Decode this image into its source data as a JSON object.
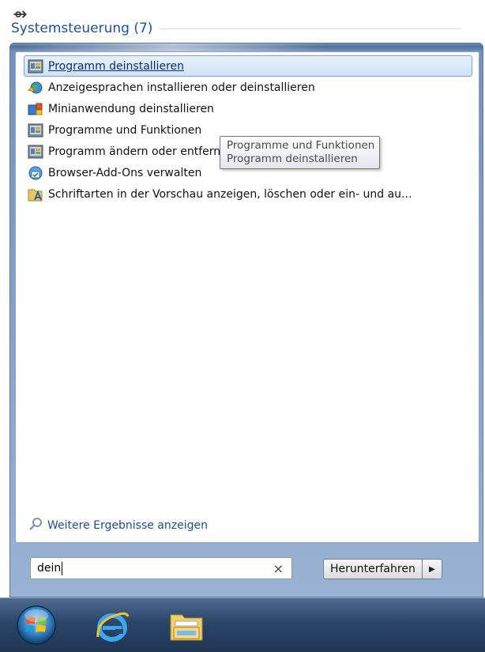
{
  "corner_glyph": "⇴",
  "start_menu": {
    "group": {
      "title": "Systemsteuerung (7)"
    },
    "results": [
      {
        "label": "Programm deinstallieren",
        "icon": "programs-features-icon",
        "selected": true
      },
      {
        "label": "Anzeigesprachen installieren oder deinstallieren",
        "icon": "globe-language-icon",
        "selected": false
      },
      {
        "label": "Minianwendung deinstallieren",
        "icon": "gadgets-icon",
        "selected": false
      },
      {
        "label": "Programme und Funktionen",
        "icon": "programs-features-icon",
        "selected": false
      },
      {
        "label": "Programm ändern oder entfernen",
        "icon": "programs-features-icon",
        "selected": false
      },
      {
        "label": "Browser-Add-Ons verwalten",
        "icon": "browser-addons-icon",
        "selected": false
      },
      {
        "label": "Schriftarten in der Vorschau anzeigen, löschen oder ein- und au...",
        "icon": "fonts-folder-icon",
        "selected": false
      }
    ],
    "tooltip": {
      "line1": "Programme und Funktionen",
      "line2": "Programm deinstallieren"
    },
    "more_results": "Weitere Ergebnisse anzeigen",
    "search": {
      "value": "dein",
      "clear_symbol": "×"
    },
    "shutdown": {
      "label": "Herunterfahren",
      "arrow": "▶"
    }
  },
  "taskbar": {
    "items": [
      "start-orb",
      "internet-explorer-icon",
      "windows-explorer-icon"
    ]
  },
  "colors": {
    "group_title": "#1e4e9a",
    "link": "#1b4d99",
    "taskbar": "#2c4669",
    "selection": "#cfe2f7"
  }
}
